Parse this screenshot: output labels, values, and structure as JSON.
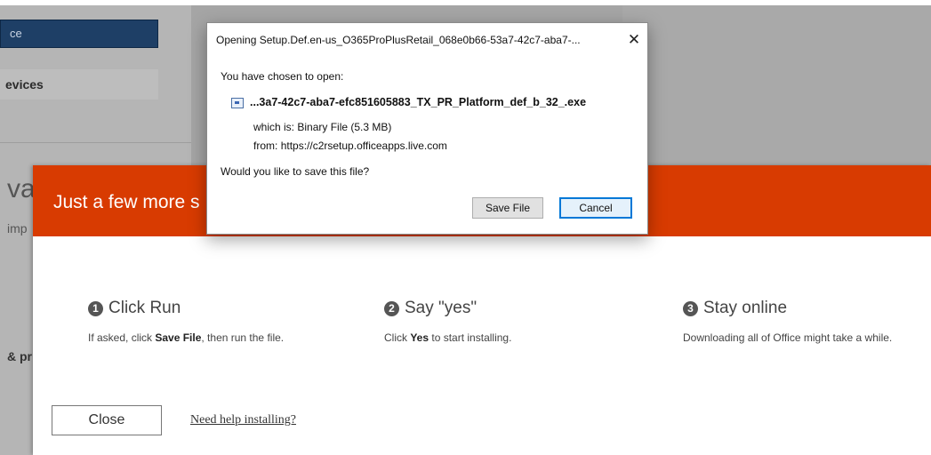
{
  "background": {
    "search_text": "ce",
    "devices_label": "evices",
    "big_text": "va",
    "imp_text": "imp",
    "pr_text": "& pr"
  },
  "installer": {
    "title": "Just a few more s",
    "accent_color": "#d83b01",
    "steps": [
      {
        "number": "1",
        "title": "Click Run",
        "desc_pre": "If asked, click ",
        "desc_bold": "Save File",
        "desc_post": ", then run the file."
      },
      {
        "number": "2",
        "title": "Say \"yes\"",
        "desc_pre": "Click ",
        "desc_bold": "Yes",
        "desc_post": " to start installing."
      },
      {
        "number": "3",
        "title": "Stay online",
        "desc_pre": "Downloading all of Office might take a while.",
        "desc_bold": "",
        "desc_post": ""
      }
    ],
    "close_label": "Close",
    "help_link": "Need help installing?"
  },
  "dialog": {
    "title": "Opening Setup.Def.en-us_O365ProPlusRetail_068e0b66-53a7-42c7-aba7-...",
    "close_glyph": "✕",
    "chosen_label": "You have chosen to open:",
    "file_name": "...3a7-42c7-aba7-efc851605883_TX_PR_Platform_def_b_32_.exe",
    "which_is_label": "which is:",
    "which_is_value": "Binary File (5.3 MB)",
    "from_label": "from:",
    "from_value": "https://c2rsetup.officeapps.live.com",
    "question": "Would you like to save this file?",
    "save_label": "Save File",
    "cancel_label": "Cancel",
    "accent_color": "#0078d7"
  }
}
